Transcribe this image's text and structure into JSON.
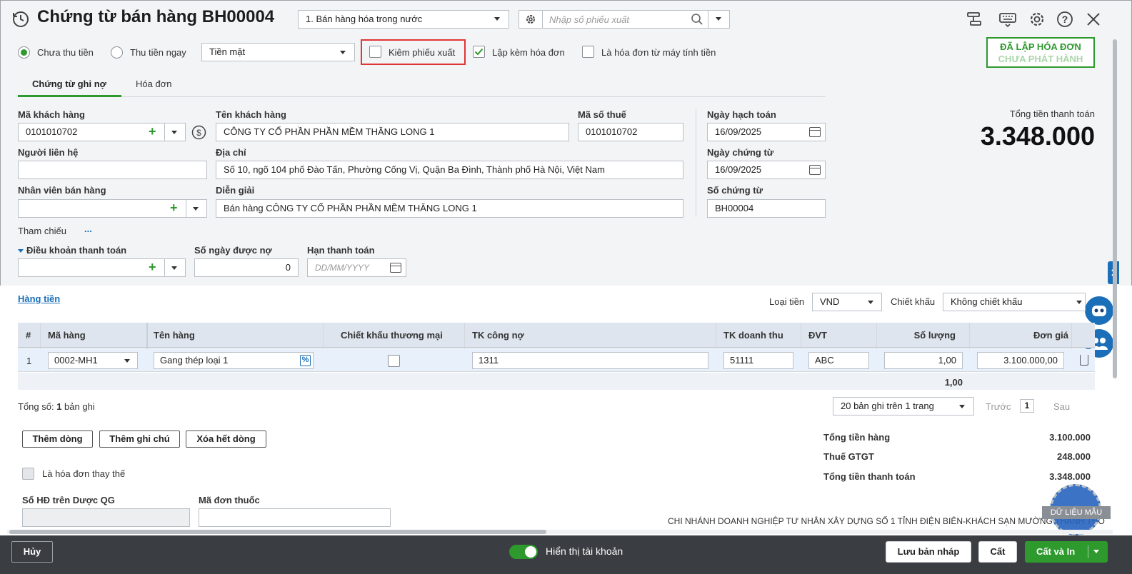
{
  "header": {
    "title": "Chứng từ bán hàng BH00004",
    "type_select": "1. Bán hàng hóa trong nước",
    "export_placeholder": "Nhập số phiếu xuất"
  },
  "options": {
    "unpaid": "Chưa thu tiền",
    "paid_now": "Thu tiền ngay",
    "payment_method": "Tiền mặt",
    "with_export_slip": "Kiêm phiếu xuất",
    "with_invoice": "Lập kèm hóa đơn",
    "cash_register_invoice": "Là hóa đơn từ máy tính tiền"
  },
  "status_badge": {
    "line1": "ĐÃ LẬP HÓA ĐƠN",
    "line2": "CHƯA PHÁT HÀNH"
  },
  "tabs": {
    "debit": "Chứng từ ghi nợ",
    "invoice": "Hóa đơn"
  },
  "form": {
    "customer_code_label": "Mã khách hàng",
    "customer_code": "0101010702",
    "customer_name_label": "Tên khách hàng",
    "customer_name": "CÔNG TY CỔ PHẦN PHẦN MỀM THĂNG LONG 1",
    "tax_code_label": "Mã số thuế",
    "tax_code": "0101010702",
    "contact_label": "Người liên hệ",
    "contact": "",
    "address_label": "Địa chỉ",
    "address": "Số 10, ngõ 104 phố Đào Tấn, Phường Cống Vị, Quận Ba Đình, Thành phố Hà Nội, Việt Nam",
    "sales_staff_label": "Nhân viên bán hàng",
    "sales_staff": "",
    "description_label": "Diễn giải",
    "description": "Bán hàng CÔNG TY CỔ PHẦN PHẦN MỀM THĂNG LONG 1",
    "reference_label": "Tham chiếu",
    "reference_more": "...",
    "payment_terms_label": "Điều khoản thanh toán",
    "payment_terms": "",
    "credit_days_label": "Số ngày được nợ",
    "credit_days": "0",
    "due_date_label": "Hạn thanh toán",
    "due_date_placeholder": "DD/MM/YYYY",
    "posting_date_label": "Ngày hạch toán",
    "posting_date": "16/09/2025",
    "voucher_date_label": "Ngày chứng từ",
    "voucher_date": "16/09/2025",
    "voucher_no_label": "Số chứng từ",
    "voucher_no": "BH00004"
  },
  "total_box": {
    "label": "Tổng tiền thanh toán",
    "amount": "3.348.000"
  },
  "goods": {
    "section_link": "Hàng tiền",
    "currency_label": "Loại tiền",
    "currency": "VND",
    "discount_label": "Chiết khấu",
    "discount": "Không chiết khấu",
    "columns": [
      "#",
      "Mã hàng",
      "Tên hàng",
      "Chiết khấu thương mại",
      "TK công nợ",
      "TK doanh thu",
      "ĐVT",
      "Số lượng",
      "Đơn giá"
    ],
    "row": {
      "no": "1",
      "code": "0002-MH1",
      "name": "Gang thép loại 1",
      "debit_account": "1311",
      "revenue_account": "51111",
      "unit": "ABC",
      "quantity": "1,00",
      "unit_price": "3.100.000,00"
    },
    "sum_quantity": "1,00"
  },
  "pager": {
    "total_prefix": "Tổng số: ",
    "total_count": "1",
    "total_suffix": " bản ghi",
    "page_size": "20 bản ghi trên 1 trang",
    "prev": "Trước",
    "page": "1",
    "next": "Sau"
  },
  "actions": {
    "add_row": "Thêm dòng",
    "add_note": "Thêm ghi chú",
    "delete_all": "Xóa hết dòng"
  },
  "replacement_invoice": "Là hóa đơn thay thế",
  "pharmacy": {
    "national_no_label": "Số HĐ trên Dược QG",
    "prescription_label": "Mã đơn thuốc"
  },
  "summary": {
    "goods_total_label": "Tổng tiền hàng",
    "goods_total": "3.100.000",
    "vat_label": "Thuế GTGT",
    "vat": "248.000",
    "grand_total_label": "Tổng tiền thanh toán",
    "grand_total": "3.348.000"
  },
  "seller_line": "CHI NHÁNH DOANH NGHIỆP TƯ NHÂN XÂY DỰNG SỐ 1 TỈNH ĐIỆN BIÊN-KHÁCH SẠN MƯỜNG THANH THO",
  "stamp": "DỮ LIỆU MẪU",
  "footer": {
    "cancel": "Hủy",
    "show_account": "Hiển thị tài khoản",
    "save_draft": "Lưu bản nháp",
    "save": "Cất",
    "save_print": "Cất và In"
  },
  "colors": {
    "accent": "#2e9a2e",
    "link": "#1b6fb8",
    "highlight_border": "#e03535",
    "footer_bg": "#3a3d42"
  }
}
